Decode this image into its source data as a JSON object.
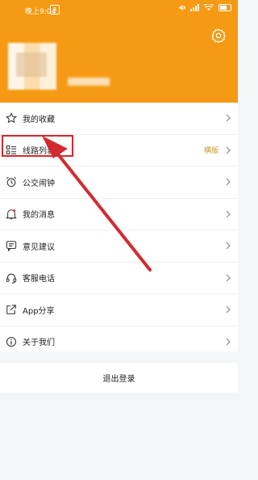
{
  "status_bar": {
    "time": "晚上9:04",
    "badge": "3"
  },
  "menu": {
    "items": [
      {
        "label": "我的收藏",
        "icon": "star-icon"
      },
      {
        "label": "线路列表",
        "icon": "list-icon",
        "extra": "横版"
      },
      {
        "label": "公交闹钟",
        "icon": "alarm-clock-icon"
      },
      {
        "label": "我的消息",
        "icon": "bell-icon"
      },
      {
        "label": "意见建议",
        "icon": "feedback-icon"
      },
      {
        "label": "客服电话",
        "icon": "headset-icon"
      },
      {
        "label": "App分享",
        "icon": "share-icon"
      },
      {
        "label": "关于我们",
        "icon": "info-icon"
      }
    ]
  },
  "logout_label": "退出登录",
  "colors": {
    "header": "#f59a12",
    "highlight": "#d12b2f",
    "extra_text": "#c89a2a"
  }
}
